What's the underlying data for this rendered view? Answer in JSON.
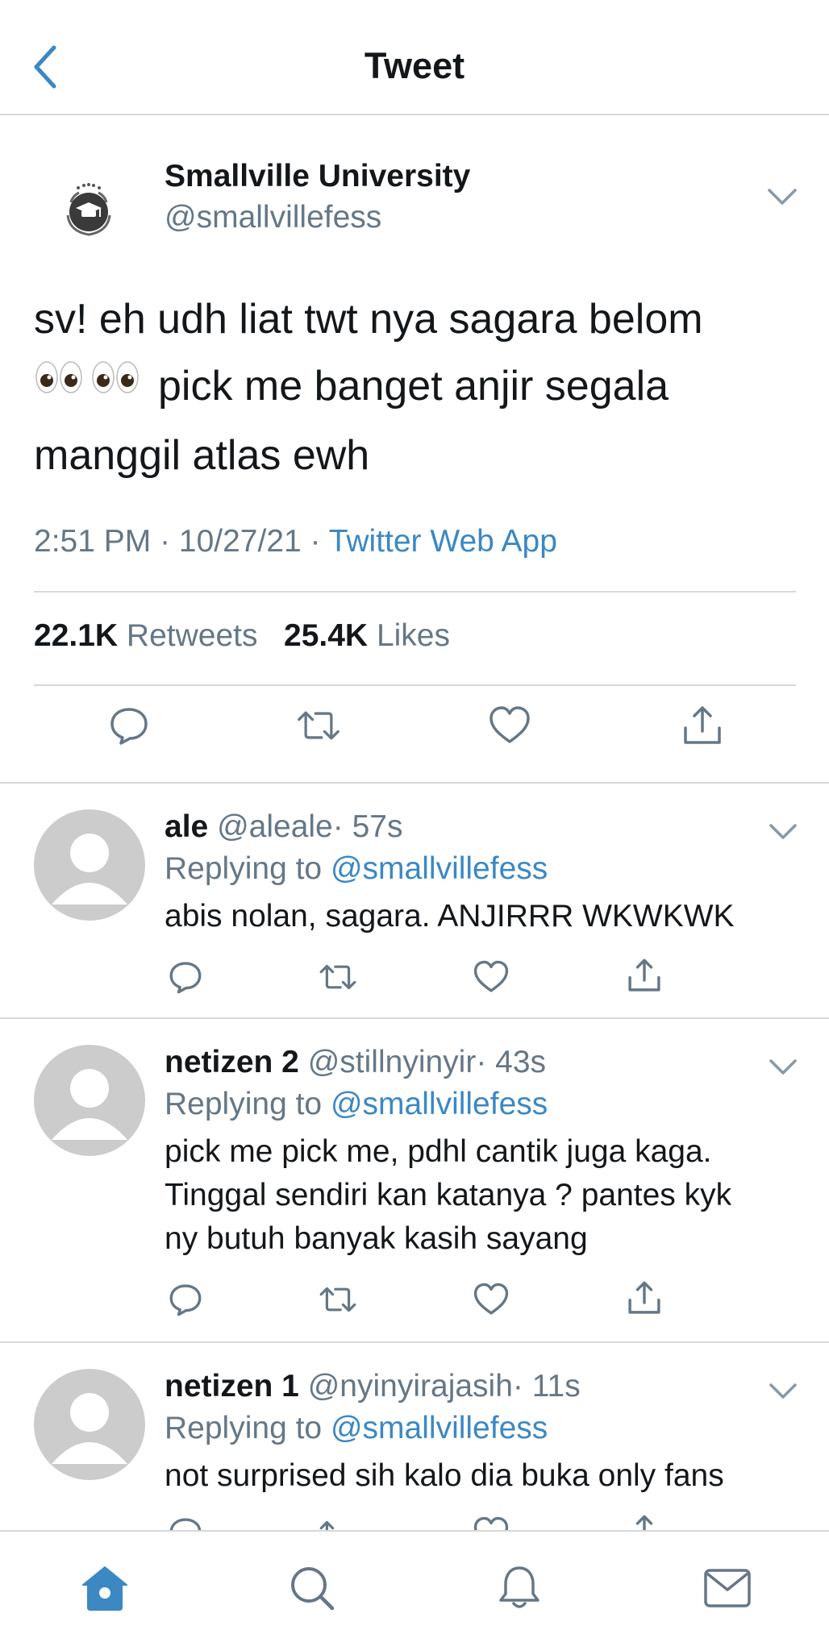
{
  "header": {
    "title": "Tweet",
    "back_icon": "chevron-left-icon"
  },
  "main_tweet": {
    "author_name": "Smallville University",
    "author_handle": "@smallvillefess",
    "text_line1": "sv! eh udh liat twt nya sagara belom",
    "text_line2_emoji": "👀👀",
    "text_line2": "pick me banget anjir segala",
    "text_line3": "manggil atlas ewh",
    "time": "2:51 PM · 10/27/21 ·",
    "source": "Twitter Web App",
    "retweets_count": "22.1K",
    "retweets_label": "Retweets",
    "likes_count": "25.4K",
    "likes_label": "Likes"
  },
  "replies": [
    {
      "name": "ale",
      "handle": "@aleale",
      "time": "· 57s",
      "replying_prefix": "Replying to",
      "replying_to": "@smallvillefess",
      "text": "abis nolan, sagara. ANJIRRR WKWKWK"
    },
    {
      "name": "netizen 2",
      "handle": "@stillnyinyir",
      "time": "· 43s",
      "replying_prefix": "Replying to",
      "replying_to": "@smallvillefess",
      "text_lines": [
        "pick me pick me, pdhl cantik juga kaga.",
        "Tinggal sendiri kan katanya ? pantes kyk",
        "ny butuh banyak kasih sayang"
      ]
    },
    {
      "name": "netizen 1",
      "handle": "@nyinyirajasih",
      "time": "· 11s",
      "replying_prefix": "Replying to",
      "replying_to": "@smallvillefess",
      "text": "not surprised sih kalo dia buka only fans"
    }
  ],
  "tabbar": {
    "items": [
      "home-icon",
      "search-icon",
      "notifications-icon",
      "messages-icon"
    ],
    "active": "home-icon"
  },
  "colors": {
    "accent": "#3b88c3",
    "text": "#14171a",
    "muted": "#657786",
    "border": "#d5d9dc",
    "avatar_placeholder": "#cccccc"
  }
}
